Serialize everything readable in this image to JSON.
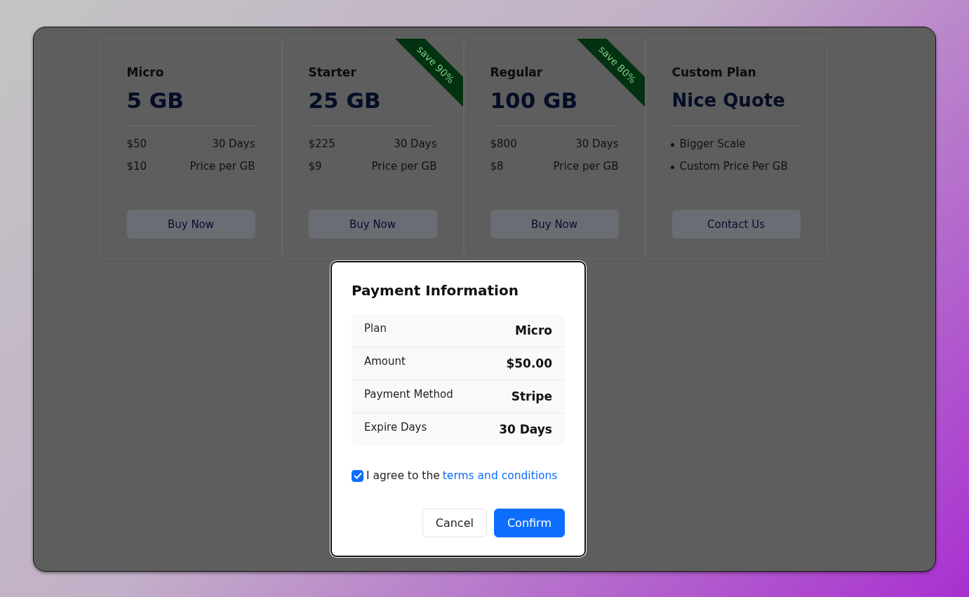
{
  "plans": [
    {
      "kind": "plan",
      "name": "Micro",
      "size": "5 GB",
      "rows": [
        [
          "$50",
          "30 Days"
        ],
        [
          "$10",
          "Price per GB"
        ]
      ],
      "button": "Buy Now"
    },
    {
      "kind": "plan",
      "name": "Starter",
      "size": "25 GB",
      "ribbon": "save 90%",
      "rows": [
        [
          "$225",
          "30 Days"
        ],
        [
          "$9",
          "Price per GB"
        ]
      ],
      "button": "Buy Now"
    },
    {
      "kind": "plan",
      "name": "Regular",
      "size": "100 GB",
      "ribbon": "save 80%",
      "rows": [
        [
          "$800",
          "30 Days"
        ],
        [
          "$8",
          "Price per GB"
        ]
      ],
      "button": "Buy Now"
    },
    {
      "kind": "custom",
      "name": "Custom Plan",
      "size": "Nice Quote",
      "bullets": [
        "Bigger Scale",
        "Custom Price Per GB"
      ],
      "button": "Contact Us"
    }
  ],
  "dialog": {
    "title": "Payment Information",
    "details": [
      {
        "label": "Plan",
        "value": "Micro"
      },
      {
        "label": "Amount",
        "value": "$50.00"
      },
      {
        "label": "Payment Method",
        "value": "Stripe"
      },
      {
        "label": "Expire Days",
        "value": "30 Days"
      }
    ],
    "agree": {
      "checked": true,
      "text": "I agree to the",
      "link": "terms and conditions"
    },
    "buttons": [
      {
        "kind": "secondary",
        "label": "Cancel"
      },
      {
        "kind": "primary",
        "label": "Confirm"
      }
    ]
  }
}
